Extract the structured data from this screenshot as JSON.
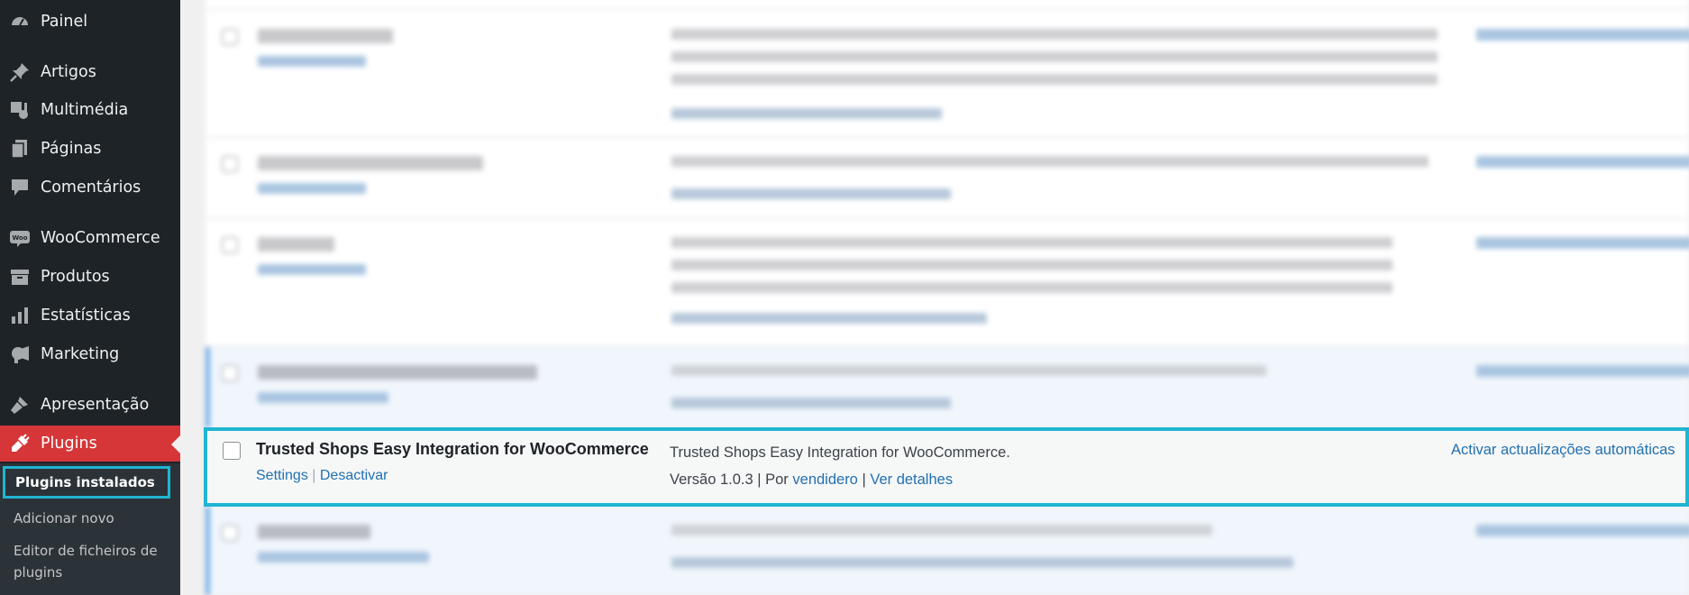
{
  "sidebar": {
    "items": [
      {
        "label": "Painel",
        "icon": "dashboard-icon"
      },
      {
        "label": "Artigos",
        "icon": "pin-icon"
      },
      {
        "label": "Multimédia",
        "icon": "media-icon"
      },
      {
        "label": "Páginas",
        "icon": "pages-icon"
      },
      {
        "label": "Comentários",
        "icon": "comments-icon"
      },
      {
        "label": "WooCommerce",
        "icon": "woocommerce-icon"
      },
      {
        "label": "Produtos",
        "icon": "products-icon"
      },
      {
        "label": "Estatísticas",
        "icon": "stats-icon"
      },
      {
        "label": "Marketing",
        "icon": "megaphone-icon"
      },
      {
        "label": "Apresentação",
        "icon": "brush-icon"
      },
      {
        "label": "Plugins",
        "icon": "plugin-icon"
      }
    ],
    "submenu": [
      {
        "label": "Plugins instalados"
      },
      {
        "label": "Adicionar novo"
      },
      {
        "label": "Editor de ficheiros de plugins"
      }
    ]
  },
  "plugins": {
    "highlighted": {
      "name": "Trusted Shops Easy Integration for WooCommerce",
      "action_settings": "Settings",
      "action_deactivate": "Desactivar",
      "description": "Trusted Shops Easy Integration for WooCommerce.",
      "version": "Versão 1.0.3",
      "by": "| Por",
      "author": "vendidero",
      "details": "Ver detalhes",
      "auto_update": "Activar actualizações automáticas"
    }
  },
  "colors": {
    "highlight": "#20b4d2",
    "link": "#2271b1",
    "active_menu": "#d63638",
    "sidebar_bg": "#1d2327"
  }
}
